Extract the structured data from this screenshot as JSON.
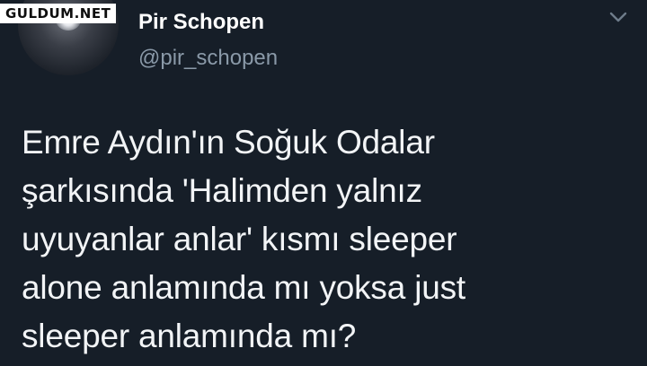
{
  "watermark": {
    "text": "GULDUM.NET"
  },
  "author": {
    "name": "Pir Schopen",
    "handle": "@pir_schopen",
    "avatar_icon": "profile-photo"
  },
  "menu": {
    "icon": "chevron-down-icon"
  },
  "tweet": {
    "lines": [
      "Emre Aydın'ın Soğuk Odalar",
      "şarkısında 'Halimden yalnız",
      "uyuyanlar anlar' kısmı sleeper",
      "alone anlamında mı yoksa just",
      "sleeper anlamında mı?"
    ]
  },
  "colors": {
    "background": "#161e28",
    "text": "#f2f4f6",
    "handle": "#8a99a8"
  }
}
